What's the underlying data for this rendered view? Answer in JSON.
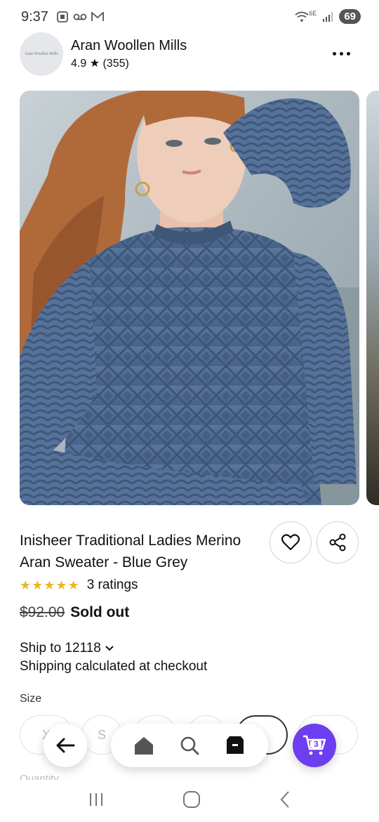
{
  "status_bar": {
    "time": "9:37",
    "network": "6E",
    "battery": "69"
  },
  "shop": {
    "logo_text": "Aran Woollen Mills",
    "name": "Aran Woollen Mills",
    "rating": "4.9 ★ (355)"
  },
  "product": {
    "title": "Inisheer Traditional Ladies Merino Aran Sweater - Blue Grey",
    "stars": "★★★★★",
    "ratings": "3 ratings",
    "old_price": "$92.00",
    "status": "Sold out",
    "ship_to": "Ship to 12118",
    "shipping_note": "Shipping calculated at checkout"
  },
  "options": {
    "size_label": "Size",
    "sizes": [
      "X",
      "S",
      "",
      "",
      "",
      "+"
    ],
    "quantity_label": "Quantity"
  },
  "cart": {
    "count": "3"
  },
  "icons": {
    "back": "arrow-left-icon",
    "home": "home-icon",
    "search": "search-icon",
    "orders": "box-icon",
    "cart": "cart-icon",
    "favorite": "heart-icon",
    "share": "share-icon",
    "more": "more-icon"
  },
  "colors": {
    "accent": "#6d3df0",
    "stars": "#e8b923",
    "sweater": "#4f6c8f"
  }
}
